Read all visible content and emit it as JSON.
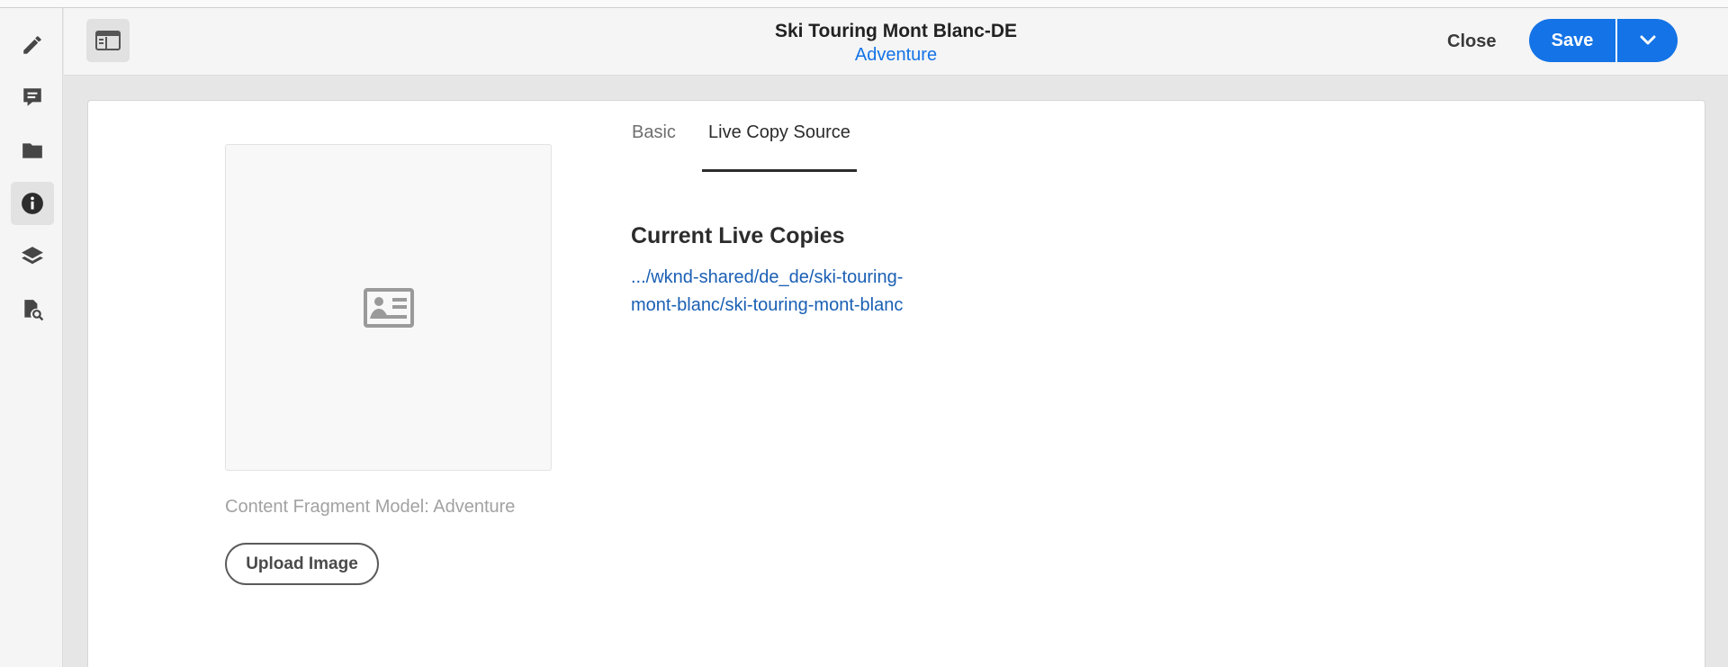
{
  "header": {
    "title": "Ski Touring Mont Blanc-DE",
    "subtitle": "Adventure",
    "close_label": "Close",
    "save_label": "Save"
  },
  "rail": {
    "items": [
      {
        "name": "edit",
        "icon": "pencil-icon"
      },
      {
        "name": "annotations",
        "icon": "comment-icon"
      },
      {
        "name": "assets",
        "icon": "folder-icon"
      },
      {
        "name": "properties",
        "icon": "info-icon",
        "active": true
      },
      {
        "name": "layers",
        "icon": "layers-icon"
      },
      {
        "name": "references",
        "icon": "search-document-icon"
      }
    ]
  },
  "fragment": {
    "model_label": "Content Fragment Model: Adventure",
    "upload_label": "Upload Image"
  },
  "tabs": {
    "basic": "Basic",
    "live_copy_source": "Live Copy Source",
    "active": "live_copy_source"
  },
  "live_copies": {
    "title": "Current Live Copies",
    "link": ".../wknd-shared/de_de/ski-touring-mont-blanc/ski-touring-mont-blanc"
  },
  "colors": {
    "accent": "#1473e6",
    "link": "#1a5fb4"
  }
}
